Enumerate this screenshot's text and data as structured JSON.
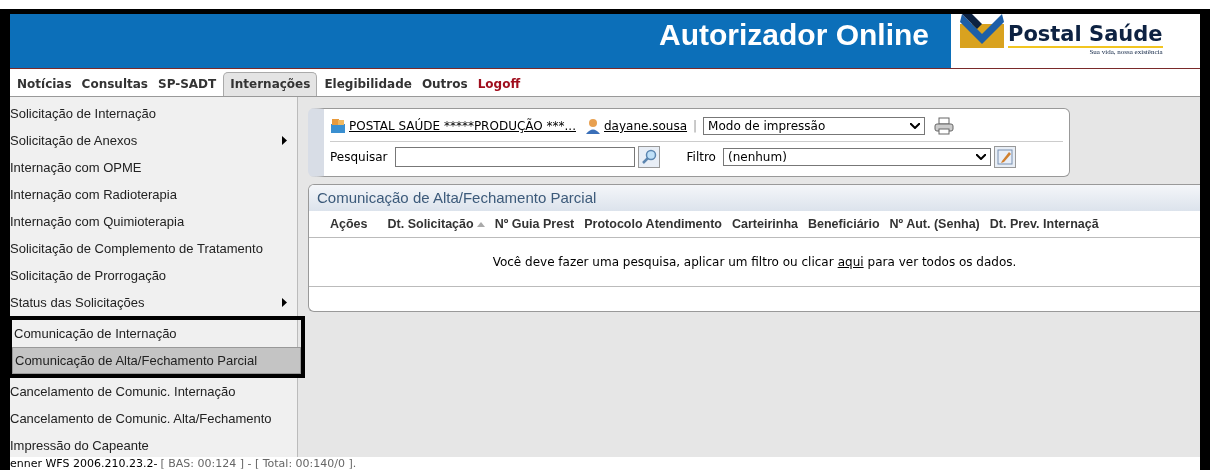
{
  "header": {
    "title": "Autorizador Online",
    "logo": {
      "name": "Postal Saúde",
      "tagline": "Sua vida, nossa existência"
    }
  },
  "tabs": [
    {
      "label": "Notícias",
      "selected": false,
      "kind": "normal"
    },
    {
      "label": "Consultas",
      "selected": false,
      "kind": "normal"
    },
    {
      "label": "SP-SADT",
      "selected": false,
      "kind": "normal"
    },
    {
      "label": "Internações",
      "selected": true,
      "kind": "normal"
    },
    {
      "label": "Elegibilidade",
      "selected": false,
      "kind": "normal"
    },
    {
      "label": "Outros",
      "selected": false,
      "kind": "normal"
    },
    {
      "label": "Logoff",
      "selected": false,
      "kind": "logout"
    }
  ],
  "sidebar": {
    "items": [
      {
        "label": "Solicitação de Internação",
        "selected": false,
        "submenu": false,
        "boxed": false
      },
      {
        "label": "Solicitação de Anexos",
        "selected": false,
        "submenu": true,
        "boxed": false
      },
      {
        "label": "Internação com OPME",
        "selected": false,
        "submenu": false,
        "boxed": false
      },
      {
        "label": "Internação com Radioterapia",
        "selected": false,
        "submenu": false,
        "boxed": false
      },
      {
        "label": "Internação com Quimioterapia",
        "selected": false,
        "submenu": false,
        "boxed": false
      },
      {
        "label": "Solicitação de Complemento de Tratamento",
        "selected": false,
        "submenu": false,
        "boxed": false
      },
      {
        "label": "Solicitação de Prorrogação",
        "selected": false,
        "submenu": false,
        "boxed": false
      },
      {
        "label": "Status das Solicitações",
        "selected": false,
        "submenu": true,
        "boxed": false
      },
      {
        "label": "Comunicação de Internação",
        "selected": false,
        "submenu": false,
        "boxed": true
      },
      {
        "label": "Comunicação de Alta/Fechamento Parcial",
        "selected": true,
        "submenu": false,
        "boxed": true
      },
      {
        "label": "Cancelamento de Comunic. Internação",
        "selected": false,
        "submenu": false,
        "boxed": false
      },
      {
        "label": "Cancelamento de Comunic. Alta/Fechamento",
        "selected": false,
        "submenu": false,
        "boxed": false
      },
      {
        "label": "Impressão do Capeante",
        "selected": false,
        "submenu": false,
        "boxed": false
      }
    ]
  },
  "toolbar": {
    "company_link": "POSTAL SAÚDE *****PRODUÇÃO ***...",
    "user_link": "dayane.sousa",
    "separator": "|",
    "print_mode": "Modo de impressão",
    "search_label": "Pesquisar",
    "filter_label": "Filtro",
    "filter_value": "(nenhum)"
  },
  "grid": {
    "title": "Comunicação de Alta/Fechamento Parcial",
    "columns": [
      {
        "label": "Ações",
        "sorted": false
      },
      {
        "label": "Dt. Solicitação",
        "sorted": true
      },
      {
        "label": "Nº Guia Prest",
        "sorted": false
      },
      {
        "label": "Protocolo Atendimento",
        "sorted": false
      },
      {
        "label": "Carteirinha",
        "sorted": false
      },
      {
        "label": "Beneficiário",
        "sorted": false
      },
      {
        "label": "Nº Aut. (Senha)",
        "sorted": false
      },
      {
        "label": "Dt. Prev. Internaçã",
        "sorted": false
      }
    ],
    "empty_message": {
      "before": "Você deve fazer uma pesquisa, aplicar um filtro ou clicar",
      "link": "aqui",
      "after": "para ver todos os dados."
    }
  },
  "status_bar": {
    "version": "enner WFS 2006.210.23.2-",
    "timing": "[ BAS: 00:124 ] - [ Total: 00:140/0 ]."
  }
}
